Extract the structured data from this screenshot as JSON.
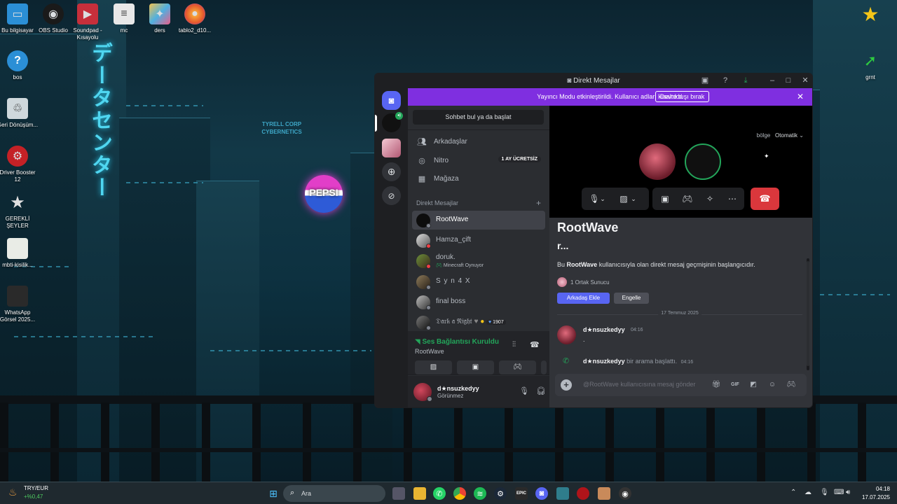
{
  "desktop": {
    "icons": [
      {
        "label": "Bu bilgisayar",
        "icon": "monitor-icon"
      },
      {
        "label": "OBS Studio",
        "icon": "obs-icon"
      },
      {
        "label": "Soundpad - Kısayolu",
        "icon": "soundpad-icon"
      },
      {
        "label": "mc",
        "icon": "file-icon"
      },
      {
        "label": "ders",
        "icon": "butterfly-icon"
      },
      {
        "label": "tablo2_d10...",
        "icon": "firefox-icon"
      },
      {
        "label": "bos",
        "icon": "help-icon"
      },
      {
        "label": "Geri Dönüşüm...",
        "icon": "recycle-bin-icon"
      },
      {
        "label": "Driver Booster 12",
        "icon": "driver-booster-icon"
      },
      {
        "label": "GEREKLİ ŞEYLER",
        "icon": "star-folder-icon"
      },
      {
        "label": "mbti-kisilik...",
        "icon": "image-file-icon"
      },
      {
        "label": "WhatsApp Görsel 2025...",
        "icon": "image-file-icon"
      },
      {
        "label": "grnt",
        "icon": "green-arrow-icon"
      }
    ],
    "wallpaper": {
      "neon_text": "データセンター",
      "small_sign": "TYRELL CORP CYBERNETICS",
      "pepsi": "PEPSI"
    }
  },
  "window": {
    "title": "Direkt Mesajlar",
    "banner": {
      "text": "Yayıncı Modu etkinleştirildi. Kullanıcı adları kısaltıldı.",
      "button": "Devre dışı bırak"
    },
    "sidebar": {
      "search": "Sohbet bul ya da başlat",
      "nav": [
        {
          "label": "Arkadaşlar",
          "icon": "friends-icon"
        },
        {
          "label": "Nitro",
          "icon": "nitro-icon",
          "badge": "1 AY ÜCRETSİZ"
        },
        {
          "label": "Mağaza",
          "icon": "shop-icon"
        }
      ],
      "dm_header": "Direkt Mesajlar",
      "dms": [
        {
          "name": "RootWave",
          "status": "offline",
          "selected": true
        },
        {
          "name": "Hamza_çift",
          "status": "dnd"
        },
        {
          "name": "doruk.",
          "status": "dnd",
          "activity": "Minecraft Oynuyor"
        },
        {
          "name": "S y n 4 X",
          "status": "offline"
        },
        {
          "name": "final boss",
          "status": "offline"
        },
        {
          "name": "𝔇𝔞𝔯𝔨 𝔞 𝔑𝔦𝔤𝔥𝔱",
          "status": "offline",
          "tag": "1907"
        }
      ],
      "voice": {
        "status": "Ses Bağlantısı Kuruldu",
        "channel": "RootWave"
      },
      "user": {
        "name": "d★nsuzkedyy",
        "status": "Görünmez"
      }
    },
    "call": {
      "region_label": "bölge",
      "region_value": "Otomatik"
    },
    "chat": {
      "title": "RootWave",
      "subtitle": "r...",
      "intro_prefix": "Bu ",
      "intro_name": "RootWave",
      "intro_suffix": " kullanıcısıyla olan direkt mesaj geçmişinin başlangıcıdır.",
      "mutual": "1 Ortak Sunucu",
      "add_friend": "Arkadaş Ekle",
      "block": "Engelle",
      "date_divider": "17 Temmuz 2025",
      "message": {
        "author": "d★nsuzkedyy",
        "time": "04:16",
        "text": "."
      },
      "call_event": {
        "author": "d★nsuzkedyy",
        "text": " bir arama başlattı.",
        "time": "04:16"
      },
      "composer_placeholder": "@RootWave kullanıcısına mesaj gönder"
    }
  },
  "taskbar": {
    "stock_name": "TRY/EUR",
    "stock_change": "+%0,47",
    "search_placeholder": "Ara",
    "time": "04:18",
    "date": "17.07.2025"
  },
  "colors": {
    "accent": "#5865f2",
    "banner": "#7f2fe0",
    "online": "#23a55a",
    "danger": "#da373c"
  }
}
